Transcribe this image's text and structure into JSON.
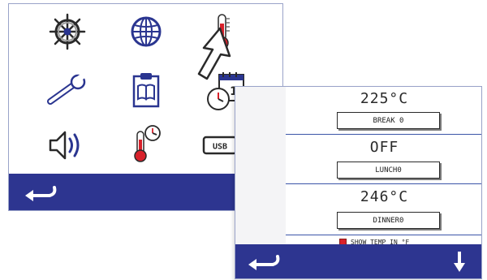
{
  "menu_screen": {
    "icons": [
      {
        "name": "ship-wheel-icon"
      },
      {
        "name": "globe-icon"
      },
      {
        "name": "thermometer-icon"
      },
      {
        "name": "wrench-icon"
      },
      {
        "name": "clipboard-book-icon"
      },
      {
        "name": "clock-calendar-icon",
        "calendar_day": "1"
      },
      {
        "name": "speaker-icon"
      },
      {
        "name": "thermometer-clock-icon"
      },
      {
        "name": "usb-icon",
        "label": "USB"
      }
    ],
    "pointer": "arrow-cursor-icon",
    "bottom_bar": {
      "back": "back-arrow-icon",
      "scroll": "down-arrow-icon"
    }
  },
  "temp_screen": {
    "rows": [
      {
        "temperature": "225°C",
        "slot_label": "BREAK 0"
      },
      {
        "temperature": "OFF",
        "slot_label": "LUNCH0"
      },
      {
        "temperature": "246°C",
        "slot_label": "DINNER0"
      }
    ],
    "show_temp_label": "SHOW TEMP IN °F",
    "show_temp_checked": true,
    "bottom_bar": {
      "back": "back-arrow-icon",
      "scroll": "down-arrow-icon"
    }
  },
  "colors": {
    "bar": "#2d3590",
    "icon_blue": "#2a3590",
    "accent_red": "#d8212b",
    "line": "#3b55a8"
  }
}
